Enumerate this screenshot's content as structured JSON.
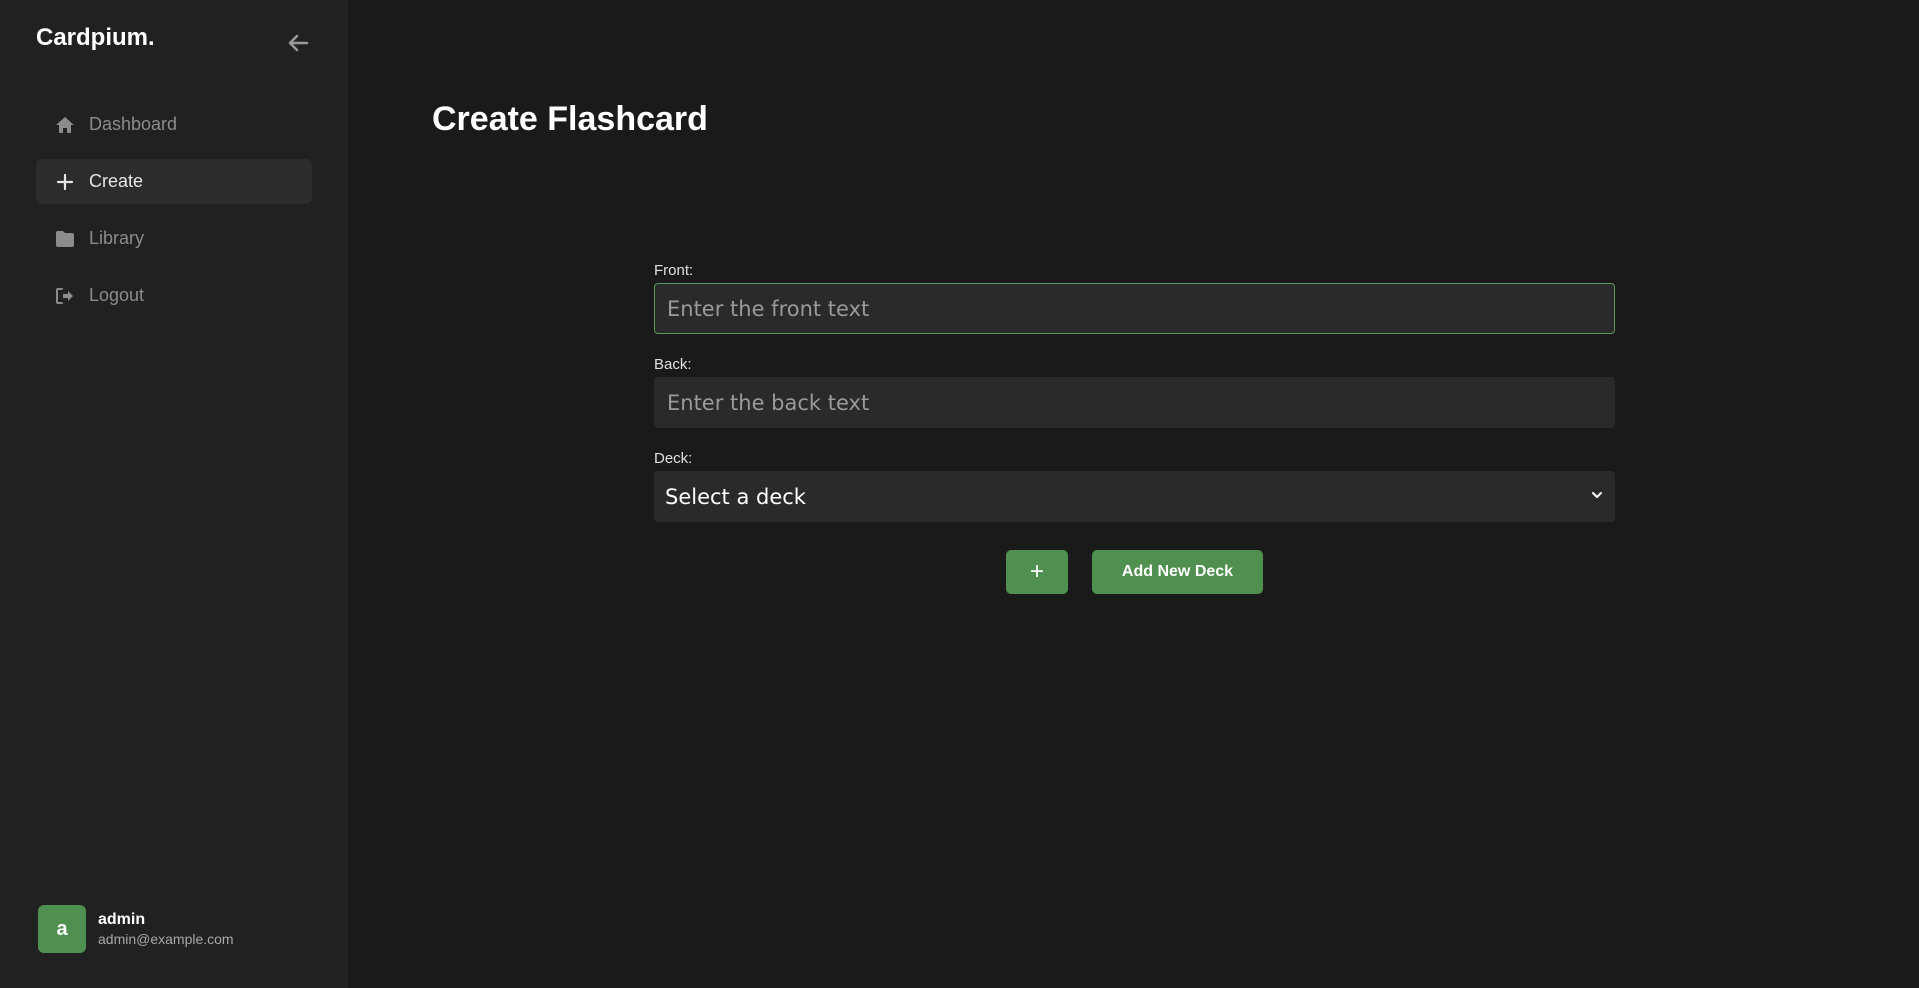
{
  "app": {
    "brand": "Cardpium."
  },
  "sidebar": {
    "collapse_icon": "arrow-left-icon",
    "items": [
      {
        "label": "Dashboard",
        "icon": "home-icon",
        "active": false
      },
      {
        "label": "Create",
        "icon": "plus-icon",
        "active": true
      },
      {
        "label": "Library",
        "icon": "folder-icon",
        "active": false
      },
      {
        "label": "Logout",
        "icon": "logout-icon",
        "active": false
      }
    ],
    "user": {
      "initial": "a",
      "name": "admin",
      "email": "admin@example.com"
    }
  },
  "main": {
    "title": "Create Flashcard",
    "front": {
      "label": "Front:",
      "value": "",
      "placeholder": "Enter the front text"
    },
    "back": {
      "label": "Back:",
      "value": "",
      "placeholder": "Enter the back text"
    },
    "deck": {
      "label": "Deck:",
      "selected": "Select a deck"
    },
    "buttons": {
      "add_icon_label": "+",
      "add_new_deck": "Add New Deck"
    }
  },
  "colors": {
    "background": "#1a1a1a",
    "sidebar": "#212121",
    "accent": "#4f8f4f",
    "input": "#2a2a2a",
    "focus_border": "#5a9a5a"
  }
}
